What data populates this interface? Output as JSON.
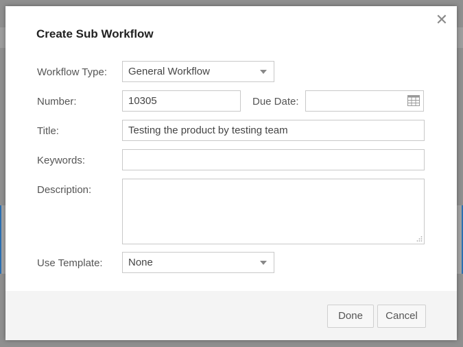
{
  "dialog": {
    "title": "Create Sub Workflow",
    "close_symbol": "✕"
  },
  "form": {
    "workflow_type": {
      "label": "Workflow Type:",
      "value": "General Workflow"
    },
    "number": {
      "label": "Number:",
      "value": "10305"
    },
    "due_date": {
      "label": "Due Date:",
      "value": ""
    },
    "title": {
      "label": "Title:",
      "value": "Testing the product by testing team"
    },
    "keywords": {
      "label": "Keywords:",
      "value": ""
    },
    "description": {
      "label": "Description:",
      "value": ""
    },
    "use_template": {
      "label": "Use Template:",
      "value": "None"
    }
  },
  "footer": {
    "done_label": "Done",
    "cancel_label": "Cancel"
  },
  "icons": {
    "close": "close-icon",
    "dropdown": "chevron-down-icon",
    "calendar": "calendar-icon",
    "resize": "resize-grip-icon"
  }
}
